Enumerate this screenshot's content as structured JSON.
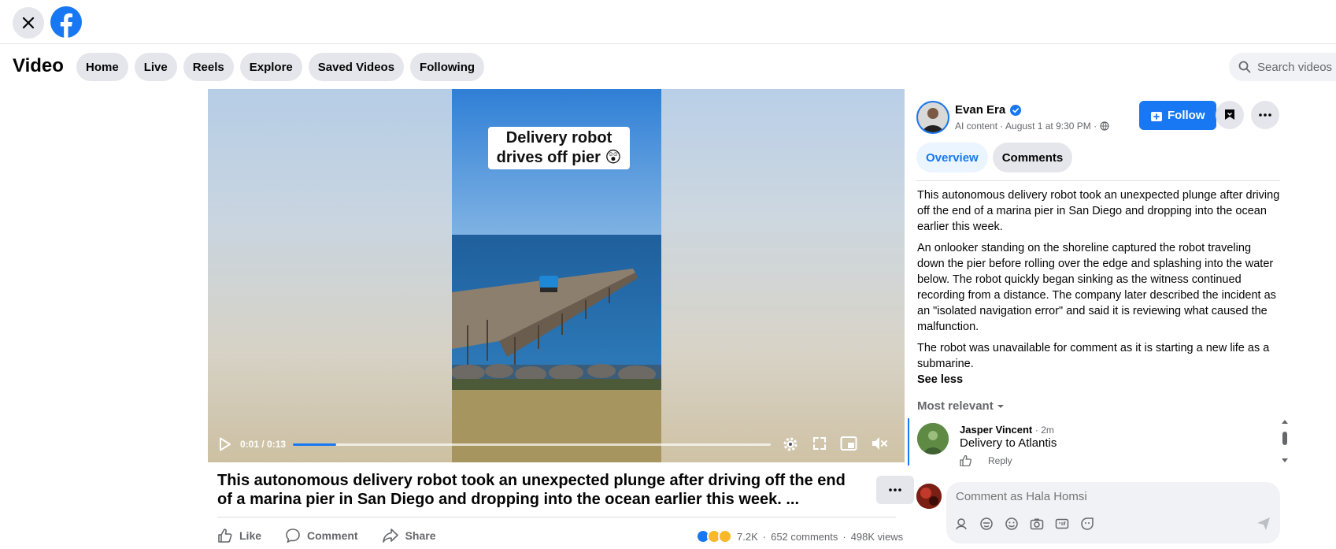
{
  "topbar": {
    "close_icon": "close-icon",
    "logo": "facebook-logo"
  },
  "video_nav": {
    "title": "Video",
    "tabs": [
      {
        "label": "Home"
      },
      {
        "label": "Live"
      },
      {
        "label": "Reels"
      },
      {
        "label": "Explore"
      },
      {
        "label": "Saved Videos"
      },
      {
        "label": "Following"
      }
    ],
    "search_placeholder": "Search videos"
  },
  "player": {
    "caption_line1": "Delivery robot",
    "caption_line2": "drives off pier 😲",
    "time": "0:01 / 0:13",
    "progress": 0.09
  },
  "post": {
    "title": "This autonomous delivery robot took an unexpected plunge after driving off the end of a marina pier in San Diego and dropping into the ocean earlier this week. ...",
    "actions": {
      "like": "Like",
      "comment": "Comment",
      "share": "Share"
    },
    "reaction_count": "7.2K",
    "comments_count": "652 comments",
    "views_count": "498K views"
  },
  "author": {
    "name": "Evan Era",
    "meta": "AI content · August 1 at 9:30 PM ·",
    "follow_label": "Follow"
  },
  "panel_tabs": [
    {
      "label": "Overview",
      "active": true
    },
    {
      "label": "Comments",
      "active": false
    }
  ],
  "description": {
    "p1": "This autonomous delivery robot took an unexpected plunge after driving off the end of a marina pier in San Diego and dropping into the ocean earlier this week.",
    "p2": "An onlooker standing on the shoreline captured the robot traveling down the pier before rolling over the edge and splashing into the water below. The robot quickly began sinking as the witness continued recording from a distance. The company later described the incident as an \"isolated navigation error\" and said it is reviewing what caused the malfunction.",
    "p3": "The robot was unavailable for comment as it is starting a new life as a submarine.",
    "see_less": "See less"
  },
  "comments": {
    "sort_label": "Most relevant",
    "items": [
      {
        "name": "Jasper Vincent",
        "time": "· 2m",
        "text": "Delivery to Atlantis",
        "reply": "Reply"
      }
    ],
    "composer_placeholder": "Comment as Hala Homsi"
  },
  "colors": {
    "accent": "#1877f2",
    "button_gray": "#e4e6eb"
  }
}
